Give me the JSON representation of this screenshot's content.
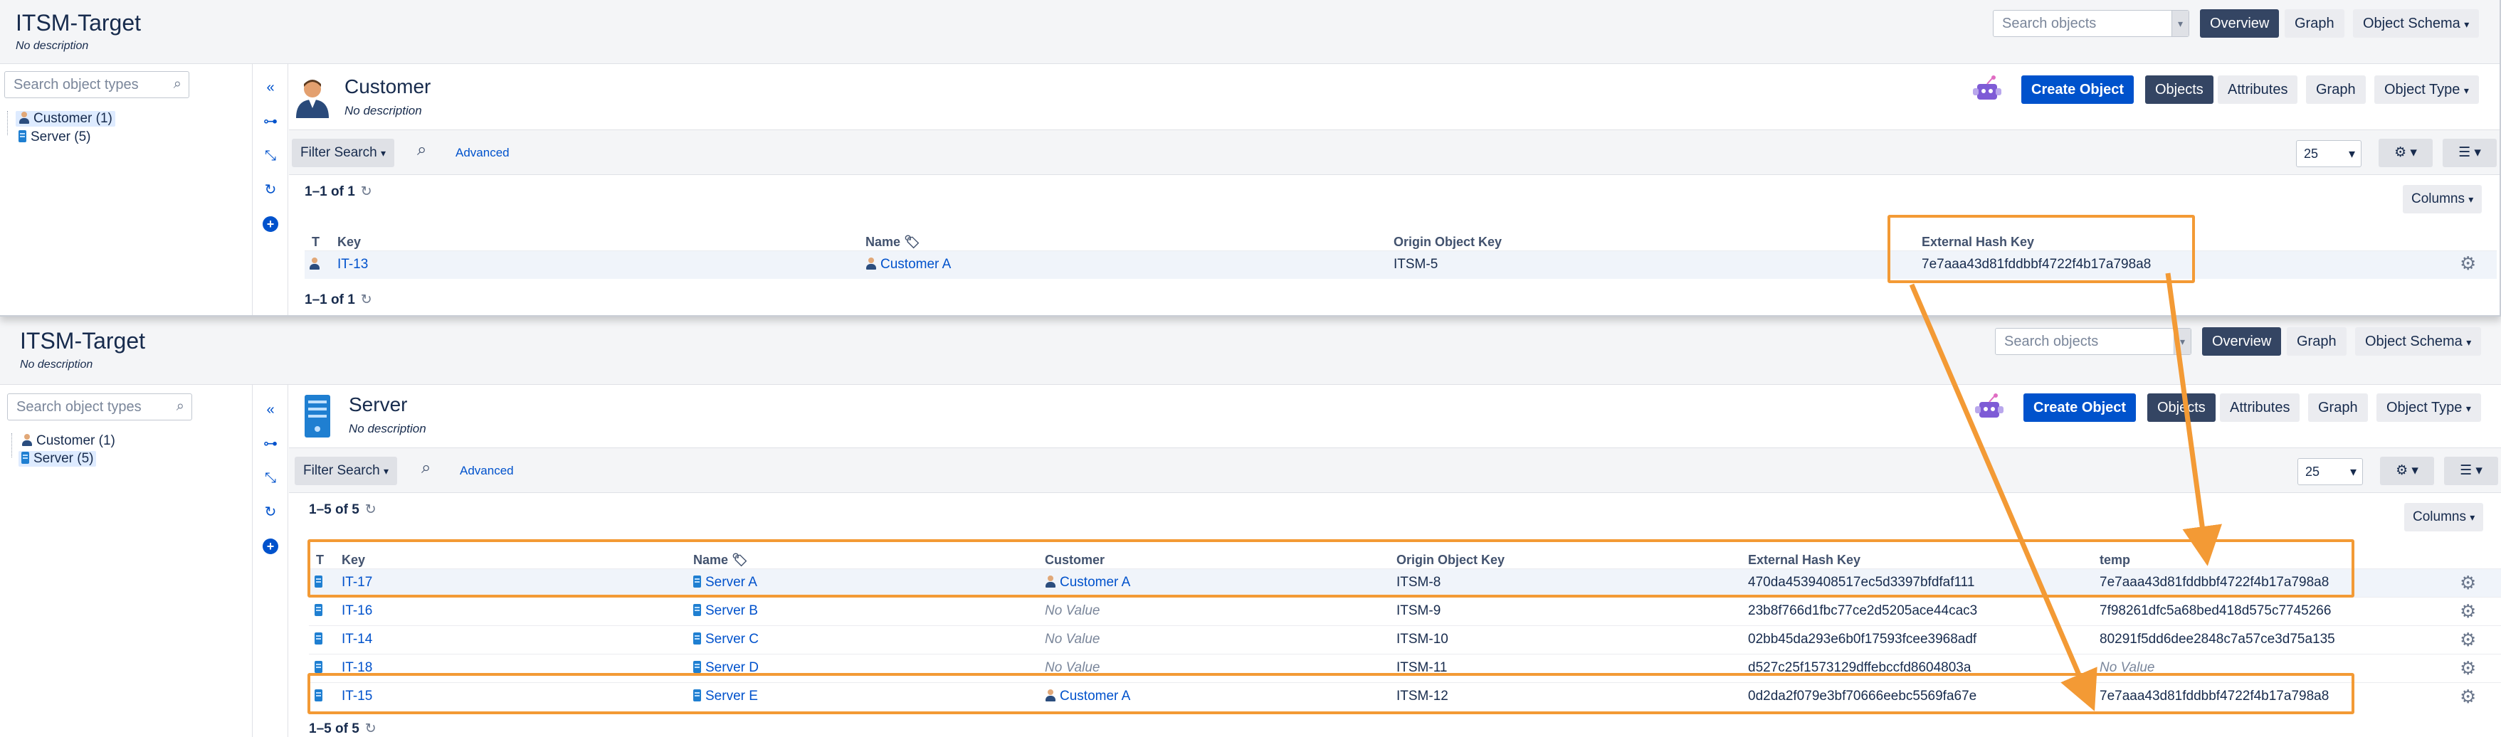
{
  "top": {
    "app_title": "ITSM-Target",
    "app_desc": "No description",
    "search_placeholder": "Search objects",
    "nav": {
      "overview": "Overview",
      "graph": "Graph",
      "object_schema": "Object Schema"
    },
    "sidebar": {
      "search_placeholder": "Search object types",
      "items": [
        {
          "label": "Customer (1)",
          "icon": "user-icon",
          "selected": true
        },
        {
          "label": "Server (5)",
          "icon": "server-icon",
          "selected": false
        }
      ]
    },
    "object_type": {
      "title": "Customer",
      "desc": "No description"
    },
    "actions": {
      "create": "Create Object",
      "objects": "Objects",
      "attributes": "Attributes",
      "graph": "Graph",
      "object_type": "Object Type"
    },
    "filter": {
      "filter_search": "Filter Search",
      "advanced": "Advanced",
      "page_size": "25",
      "columns": "Columns"
    },
    "count": "1–1 of 1",
    "table": {
      "headers": {
        "t": "T",
        "key": "Key",
        "name": "Name",
        "origin": "Origin Object Key",
        "hash": "External Hash Key"
      },
      "rows": [
        {
          "key": "IT-13",
          "name": "Customer A",
          "origin": "ITSM-5",
          "hash": "7e7aaa43d81fddbbf4722f4b17a798a8"
        }
      ]
    }
  },
  "bottom": {
    "app_title": "ITSM-Target",
    "app_desc": "No description",
    "search_placeholder": "Search objects",
    "nav": {
      "overview": "Overview",
      "graph": "Graph",
      "object_schema": "Object Schema"
    },
    "sidebar": {
      "search_placeholder": "Search object types",
      "items": [
        {
          "label": "Customer (1)",
          "icon": "user-icon",
          "selected": false
        },
        {
          "label": "Server (5)",
          "icon": "server-icon",
          "selected": true
        }
      ]
    },
    "object_type": {
      "title": "Server",
      "desc": "No description"
    },
    "actions": {
      "create": "Create Object",
      "objects": "Objects",
      "attributes": "Attributes",
      "graph": "Graph",
      "object_type": "Object Type"
    },
    "filter": {
      "filter_search": "Filter Search",
      "advanced": "Advanced",
      "page_size": "25",
      "columns": "Columns"
    },
    "count": "1–5 of 5",
    "table": {
      "headers": {
        "t": "T",
        "key": "Key",
        "name": "Name",
        "customer": "Customer",
        "origin": "Origin Object Key",
        "hash": "External Hash Key",
        "temp": "temp"
      },
      "rows": [
        {
          "key": "IT-17",
          "name": "Server A",
          "customer": "Customer A",
          "origin": "ITSM-8",
          "hash": "470da4539408517ec5d3397bfdfaf111",
          "temp": "7e7aaa43d81fddbbf4722f4b17a798a8"
        },
        {
          "key": "IT-16",
          "name": "Server B",
          "customer": "No Value",
          "origin": "ITSM-9",
          "hash": "23b8f766d1fbc77ce2d5205ace44cac3",
          "temp": "7f98261dfc5a68bed418d575c7745266"
        },
        {
          "key": "IT-14",
          "name": "Server C",
          "customer": "No Value",
          "origin": "ITSM-10",
          "hash": "02bb45da293e6b0f17593fcee3968adf",
          "temp": "80291f5dd6dee2848c7a57ce3d75a135"
        },
        {
          "key": "IT-18",
          "name": "Server D",
          "customer": "No Value",
          "origin": "ITSM-11",
          "hash": "d527c25f1573129dffebccfd8604803a",
          "temp": "No Value"
        },
        {
          "key": "IT-15",
          "name": "Server E",
          "customer": "Customer A",
          "origin": "ITSM-12",
          "hash": "0d2da2f079e3bf70666eebc5569fa67e",
          "temp": "7e7aaa43d81fddbbf4722f4b17a798a8"
        }
      ]
    }
  },
  "colors": {
    "accent": "#0052cc",
    "annotation": "#f39a35",
    "nav_dark": "#344563"
  }
}
